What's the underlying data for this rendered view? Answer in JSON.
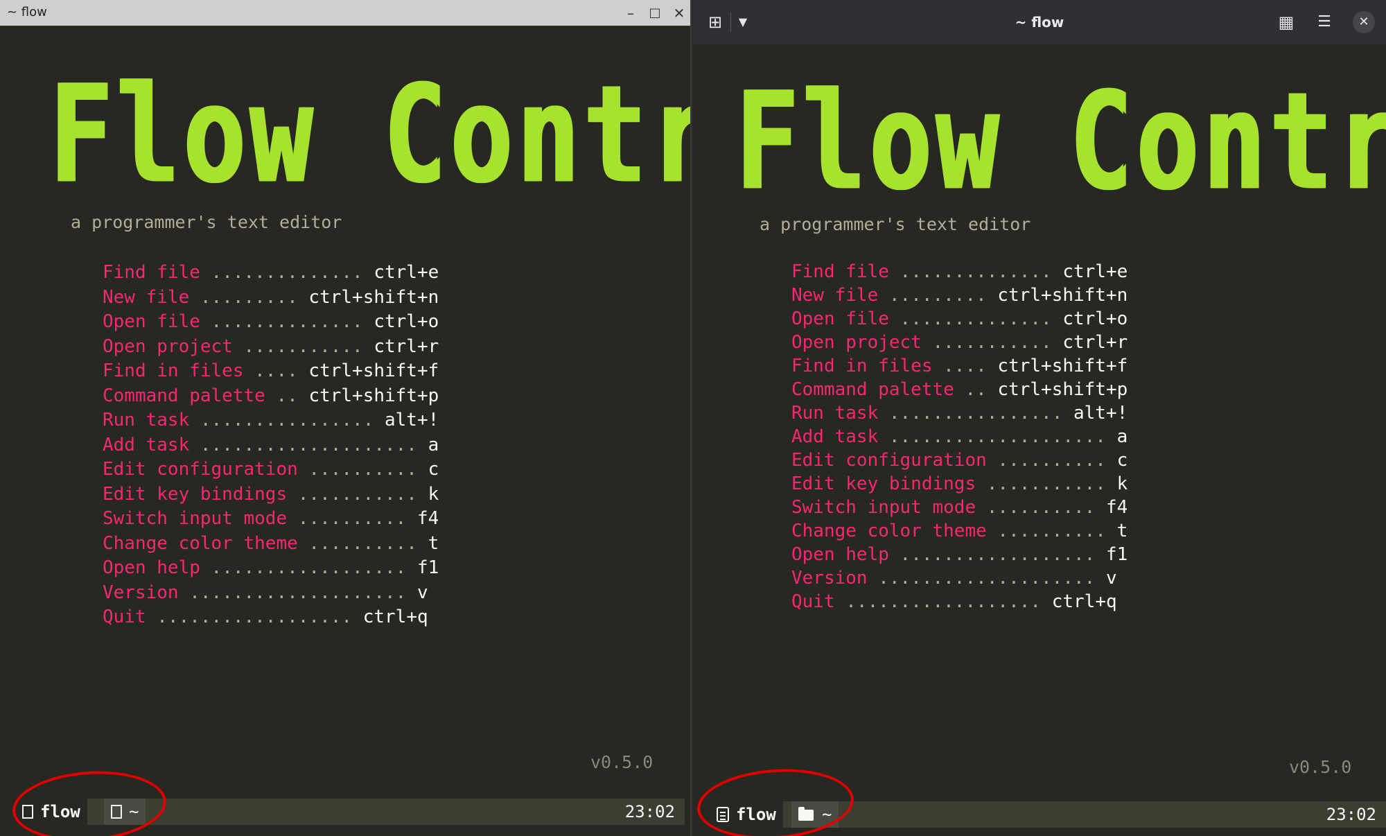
{
  "left_window": {
    "title": "~ flow",
    "controls": {
      "minimize": "–",
      "maximize": "□",
      "close": "✕"
    },
    "app_title": "Flow Control",
    "subtitle": "a programmer's text editor",
    "menu": [
      {
        "label": "Find file",
        "dots": " .............. ",
        "key": "ctrl+e"
      },
      {
        "label": "New file",
        "dots": " ......... ",
        "key": "ctrl+shift+n"
      },
      {
        "label": "Open file",
        "dots": " .............. ",
        "key": "ctrl+o"
      },
      {
        "label": "Open project",
        "dots": " ........... ",
        "key": "ctrl+r"
      },
      {
        "label": "Find in files",
        "dots": " .... ",
        "key": "ctrl+shift+f"
      },
      {
        "label": "Command palette",
        "dots": " .. ",
        "key": "ctrl+shift+p"
      },
      {
        "label": "Run task",
        "dots": " ................ ",
        "key": "alt+!"
      },
      {
        "label": "Add task",
        "dots": " .................... ",
        "key": "a"
      },
      {
        "label": "Edit configuration",
        "dots": " .......... ",
        "key": "c"
      },
      {
        "label": "Edit key bindings",
        "dots": " ........... ",
        "key": "k"
      },
      {
        "label": "Switch input mode",
        "dots": " .......... ",
        "key": "f4"
      },
      {
        "label": "Change color theme",
        "dots": " .......... ",
        "key": "t"
      },
      {
        "label": "Open help",
        "dots": " .................. ",
        "key": "f1"
      },
      {
        "label": "Version",
        "dots": " .................... ",
        "key": "v"
      },
      {
        "label": "Quit",
        "dots": " .................. ",
        "key": "ctrl+q"
      }
    ],
    "version": "v0.5.0",
    "status": {
      "name": "flow",
      "dir": "~",
      "time": "23:02"
    }
  },
  "right_window": {
    "title": "~ flow",
    "app_title": "Flow Control",
    "subtitle": "a programmer's text editor",
    "version": "v0.5.0",
    "status": {
      "name": "flow",
      "dir": "~",
      "time": "23:02"
    }
  },
  "colors": {
    "background": "#272822",
    "title_green": "#a6e22e",
    "label_pink": "#f92672",
    "key_white": "#f8f8f2",
    "annotation_red": "#e00000"
  }
}
